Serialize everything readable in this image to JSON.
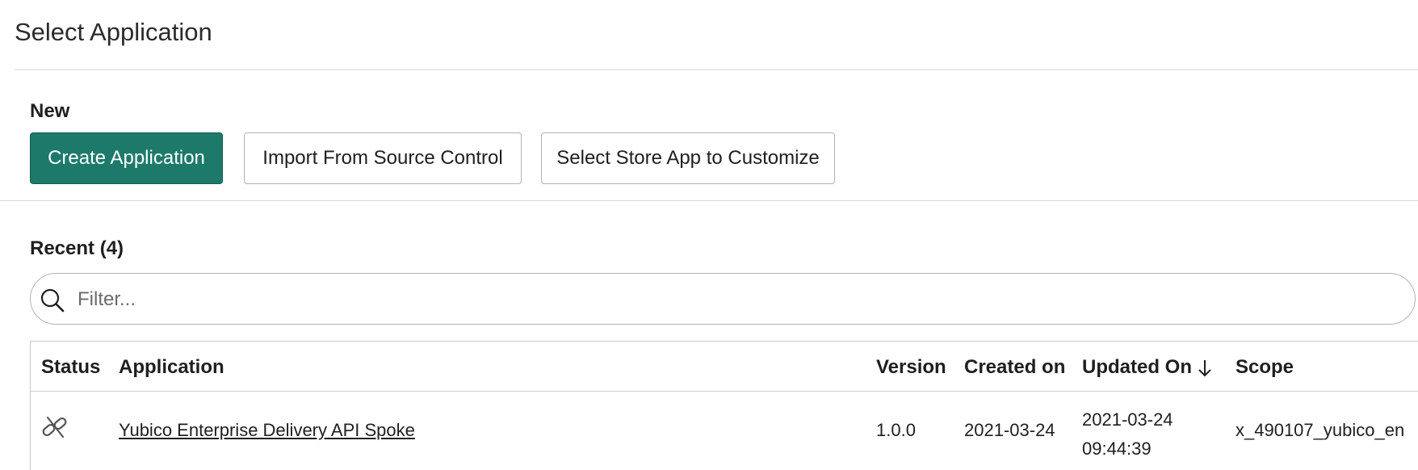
{
  "header": {
    "title": "Select Application"
  },
  "new_section": {
    "label": "New",
    "buttons": {
      "create": "Create Application",
      "import": "Import From Source Control",
      "store": "Select Store App to Customize"
    }
  },
  "recent_section": {
    "label": "Recent (4)",
    "filter": {
      "placeholder": "Filter...",
      "value": "",
      "icon": "search-icon"
    },
    "table": {
      "columns": {
        "status": "Status",
        "application": "Application",
        "version": "Version",
        "created_on": "Created on",
        "updated_on": "Updated On",
        "scope": "Scope"
      },
      "sort": {
        "column": "updated_on",
        "direction": "descending",
        "icon": "arrow-down-icon"
      },
      "rows": [
        {
          "status_icon": "link-broken-icon",
          "application": "Yubico Enterprise Delivery API Spoke",
          "version": "1.0.0",
          "created_on": "2021-03-24",
          "updated_on_date": "2021-03-24",
          "updated_on_time": "09:44:39",
          "scope": "x_490107_yubico_en"
        }
      ]
    }
  },
  "colors": {
    "primary": "#1d7a6b",
    "border": "#b3b3b3",
    "divider": "#d9d9d9"
  }
}
